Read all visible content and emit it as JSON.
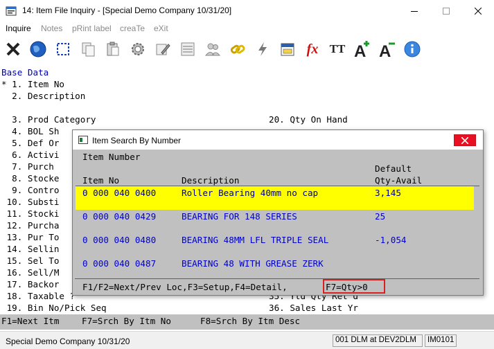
{
  "window": {
    "title": "14: Item File Inquiry - [Special Demo Company 10/31/20]"
  },
  "menu": {
    "inquire": "Inquire",
    "notes": "Notes",
    "print_label": "pRint label",
    "create": "creaTe",
    "exit": "eXit"
  },
  "toolbar": {
    "buttons": [
      "exit-icon",
      "globe-icon",
      "select-icon",
      "copy-icon",
      "paste-icon",
      "settings-icon",
      "edit-icon",
      "list-icon",
      "users-icon",
      "link-icon",
      "lightning-icon",
      "calendar-icon",
      "function-icon",
      "font-size-icon",
      "font-increase-icon",
      "font-decrease-icon",
      "help-icon"
    ],
    "fx_label": "fx",
    "tt_label": "TT"
  },
  "console": {
    "header": "Base Data",
    "lines": [
      "* 1. Item No",
      "  2. Description",
      "",
      "  3. Prod Category",
      "  4. BOL Sh",
      "  5. Def Or",
      "  6. Activi",
      "  7. Purch ",
      "  8. Stocke",
      "  9. Contro",
      " 10. Substi",
      " 11. Stocki",
      " 12. Purcha",
      " 13. Pur To",
      " 14. Sellin",
      " 15. Sel To",
      " 16. Sell/M",
      " 17. Backor",
      " 18. Taxable ?",
      " 19. Bin No/Pick Seq"
    ],
    "right_lines": {
      "qty_on_hand": "20. Qty On Hand",
      "ytd_qty_ret": "35. Ytd Qty Ret'd",
      "sales_last_yr": "36. Sales Last Yr"
    }
  },
  "fkeys": {
    "f1": "F1=Next Itm",
    "f7": "F7=Srch By Itm No",
    "f8": "F8=Srch By Itm Desc"
  },
  "status": {
    "company": "Special Demo Company 10/31/20",
    "session": "001 DLM at DEV2DLM",
    "program": "IM0101"
  },
  "dialog": {
    "title": "Item Search By Number",
    "caption": "Item Number",
    "col_item_no": "Item No",
    "col_description": "Description",
    "col_qty_line1": "Default",
    "col_qty_line2": "Qty-Avail",
    "rows": [
      {
        "item_no": "0 000 040 0400",
        "description": "Roller Bearing 40mm no cap",
        "qty": "3,145"
      },
      {
        "item_no": "0 000 040 0429",
        "description": "BEARING FOR 148 SERIES",
        "qty": "25"
      },
      {
        "item_no": "0 000 040 0480",
        "description": "BEARING 48MM LFL TRIPLE SEAL",
        "qty": "-1,054"
      },
      {
        "item_no": "0 000 040 0487",
        "description": "BEARING 48 WITH GREASE ZERK",
        "qty": ""
      }
    ],
    "footer_left": "F1/F2=Next/Prev Loc,F3=Setup,F4=Detail,",
    "footer_f7": "F7=Qty>0"
  },
  "colors": {
    "highlight": "#ffff00",
    "fkey_bar": "#c0c0c0",
    "dialog_bg": "#c0c0c0",
    "close_red": "#e81123",
    "f7_outline": "#d92020"
  }
}
